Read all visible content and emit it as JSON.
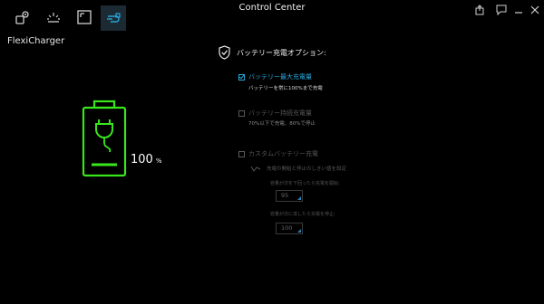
{
  "app": {
    "title": "Control Center"
  },
  "section": {
    "title": "FlexiCharger"
  },
  "battery": {
    "percent": "100",
    "unit": "%"
  },
  "options": {
    "header": "バッテリー充電オプション:",
    "max": {
      "label": "バッテリー最大充電量",
      "desc": "バッテリーを常に100%まで充電",
      "checked": true
    },
    "health": {
      "label": "バッテリー持続充電量",
      "desc": "70%以下で充電、80%で停止",
      "checked": false
    },
    "custom": {
      "label": "カスタムバッテリー充電",
      "checked": false,
      "subtitle": "充電の開始と停止のしきい値を設定",
      "start_label": "容量が次を下回ったら充電を開始:",
      "start_value": "95",
      "stop_label": "容量が次に達したら充電を停止:",
      "stop_value": "100"
    }
  },
  "colors": {
    "accent": "#2aa6d8",
    "battery": "#39e61c",
    "background": "#000000"
  },
  "icons": {
    "tabs": [
      "system-settings-icon",
      "brightness-icon",
      "display-icon",
      "flexicharger-icon"
    ],
    "window": [
      "export-icon",
      "chat-icon",
      "minimize-icon",
      "close-icon"
    ]
  }
}
